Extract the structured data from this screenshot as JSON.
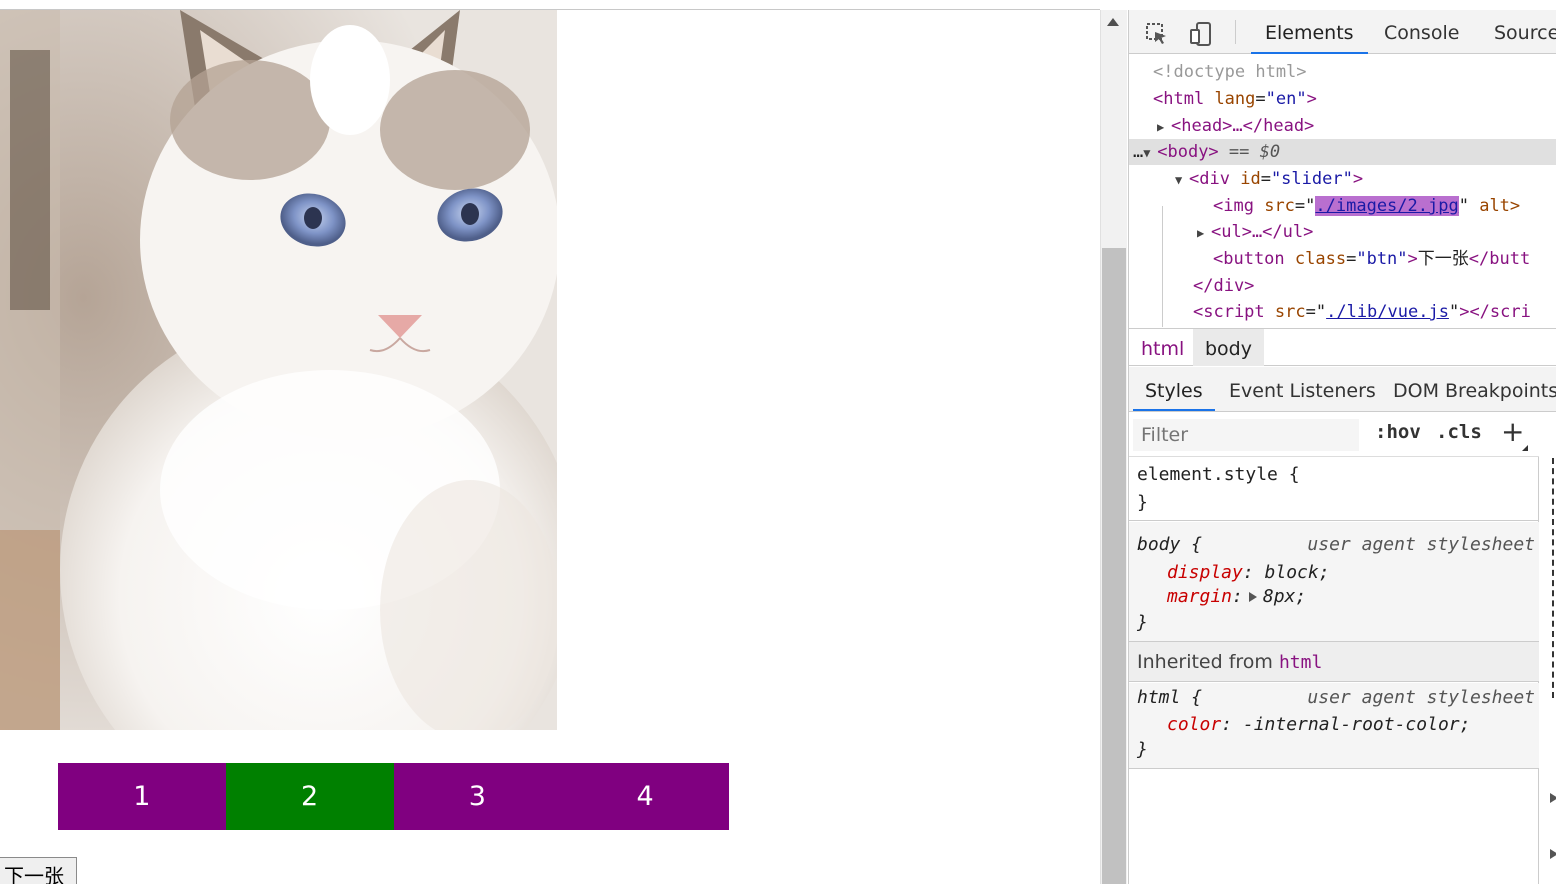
{
  "page": {
    "pager_items": [
      {
        "label": "1",
        "color": "#800080"
      },
      {
        "label": "2",
        "color": "#008000"
      },
      {
        "label": "3",
        "color": "#800080"
      },
      {
        "label": "4",
        "color": "#800080"
      }
    ],
    "next_button_label": "下一张"
  },
  "devtools": {
    "tabs": [
      "Elements",
      "Console",
      "Source"
    ],
    "active_tab": "Elements",
    "dom": {
      "doctype": "<!doctype html>",
      "html_open": "<html",
      "html_lang_attr": "lang",
      "html_lang_val": "\"en\"",
      "html_close": ">",
      "head": "<head>…</head>",
      "body_open": "<body>",
      "body_eq": "== $0",
      "div_open": "<div",
      "div_attr": "id",
      "div_val": "\"slider\"",
      "div_close": ">",
      "img_open": "<img",
      "img_attr": "src",
      "img_src": "./images/2.jpg",
      "img_alt": "alt>",
      "ul": "<ul>…</ul>",
      "button_open": "<button",
      "button_attr": "class",
      "button_val": "\"btn\"",
      "button_text": "下一张",
      "button_close": "</butt",
      "div_end": "</div>",
      "script_open": "<script",
      "script_attr": "src",
      "script_src": "./lib/vue.js",
      "script_close": "</scri"
    },
    "breadcrumbs": [
      "html",
      "body"
    ],
    "subtabs": [
      "Styles",
      "Event Listeners",
      "DOM Breakpoints"
    ],
    "filter_placeholder": "Filter",
    "hov": ":hov",
    "cls": ".cls",
    "add": "+",
    "rules": {
      "element_style_selector": "element.style {",
      "close_brace": "}",
      "body_selector": "body {",
      "body_source": "user agent stylesheet",
      "body_prop1": "display",
      "body_val1": "block;",
      "body_prop2": "margin",
      "body_val2": "8px;",
      "inherited_label": "Inherited from",
      "inherited_tag": "html",
      "html_selector": "html {",
      "html_source": "user agent stylesheet",
      "html_prop1": "color",
      "html_val1": "-internal-root-color;"
    }
  }
}
